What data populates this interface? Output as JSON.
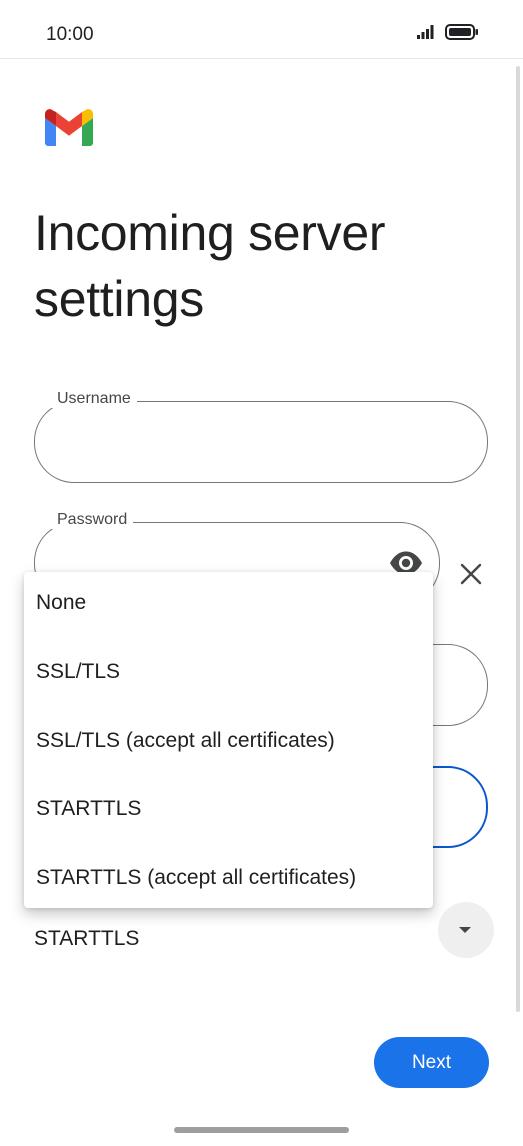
{
  "status_bar": {
    "time": "10:00"
  },
  "page": {
    "title": "Incoming server settings"
  },
  "form": {
    "username_label": "Username",
    "password_label": "Password"
  },
  "dropdown": {
    "options": [
      "None",
      "SSL/TLS",
      "SSL/TLS (accept all certificates)",
      "STARTTLS",
      "STARTTLS (accept all certificates)"
    ]
  },
  "security_select": {
    "value": "STARTTLS"
  },
  "actions": {
    "next_label": "Next"
  },
  "colors": {
    "accent": "#1a73e8",
    "active_border": "#0b57d0"
  }
}
